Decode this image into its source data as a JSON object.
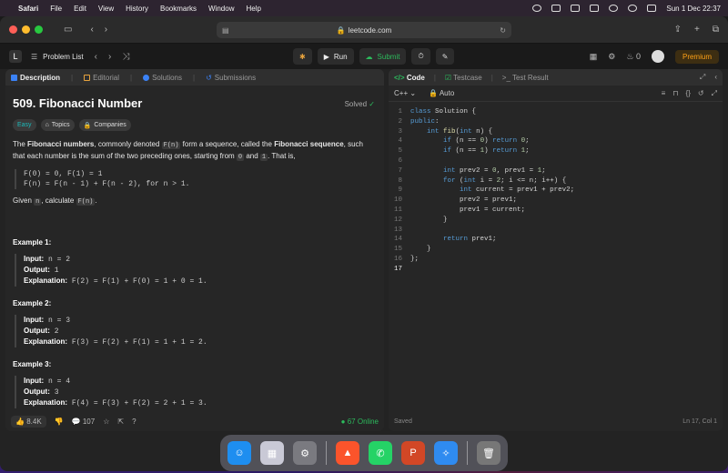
{
  "menubar": {
    "apple": "",
    "app": "Safari",
    "items": [
      "File",
      "Edit",
      "View",
      "History",
      "Bookmarks",
      "Window",
      "Help"
    ],
    "datetime": "Sun 1 Dec  22:37"
  },
  "browser": {
    "url": "leetcode.com"
  },
  "leetcode": {
    "problem_list": "Problem List",
    "run": "Run",
    "submit": "Submit",
    "notifications": "0",
    "premium": "Premium"
  },
  "left_tabs": [
    "Description",
    "Editorial",
    "Solutions",
    "Submissions"
  ],
  "problem": {
    "title": "509. Fibonacci Number",
    "status": "Solved",
    "difficulty": "Easy",
    "topics": "Topics",
    "companies": "Companies",
    "p1_a": "The ",
    "p1_b": "Fibonacci numbers",
    "p1_c": ", commonly denoted ",
    "p1_d": "F(n)",
    "p1_e": " form a sequence, called the ",
    "p1_f": "Fibonacci sequence",
    "p1_g": ", such that each number is the sum of the two preceding ones, starting from ",
    "p1_h": "0",
    "p1_i": " and ",
    "p1_j": "1",
    "p1_k": ". That is,",
    "formula1": "F(0) = 0, F(1) = 1",
    "formula2": "F(n) = F(n - 1) + F(n - 2), for n > 1.",
    "given_a": "Given ",
    "given_b": "n",
    "given_c": ", calculate ",
    "given_d": "F(n)",
    "given_e": "."
  },
  "examples": [
    {
      "title": "Example 1:",
      "input": "n = 2",
      "output": "1",
      "explanation": "F(2) = F(1) + F(0) = 1 + 0 = 1."
    },
    {
      "title": "Example 2:",
      "input": "n = 3",
      "output": "2",
      "explanation": "F(3) = F(2) + F(1) = 1 + 1 = 2."
    },
    {
      "title": "Example 3:",
      "input": "n = 4",
      "output": "3",
      "explanation": "F(4) = F(3) + F(2) = 2 + 1 = 3."
    }
  ],
  "example_labels": {
    "input": "Input:",
    "output": "Output:",
    "explanation": "Explanation:"
  },
  "left_footer": {
    "likes": "8.4K",
    "comments": "107",
    "online_count": "67",
    "online_label": "Online"
  },
  "right_tabs": [
    "Code",
    "Testcase",
    "Test Result"
  ],
  "editor": {
    "language": "C++",
    "mode": "Auto",
    "status": "Saved",
    "cursor": "Ln 17, Col 1"
  },
  "code_lines": [
    "class Solution {",
    "public:",
    "    int fib(int n) {",
    "        if (n == 0) return 0;",
    "        if (n == 1) return 1;",
    "",
    "        int prev2 = 0, prev1 = 1;",
    "        for (int i = 2; i <= n; i++) {",
    "            int current = prev1 + prev2;",
    "            prev2 = prev1;",
    "            prev1 = current;",
    "        }",
    "",
    "        return prev1;",
    "    }",
    "};",
    ""
  ],
  "colors": {
    "accent_green": "#2cbb5d",
    "premium": "#ffa116",
    "easy": "#1cbaba"
  }
}
